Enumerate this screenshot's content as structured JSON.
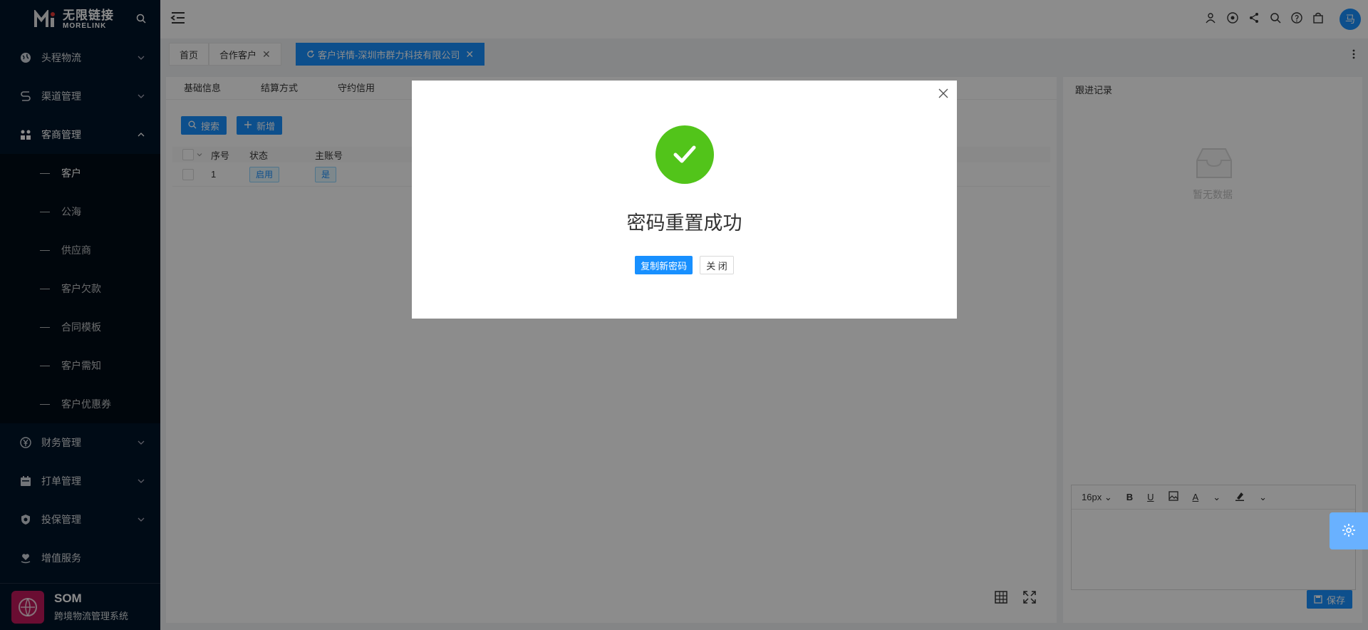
{
  "brand": {
    "name_cn": "无限链接",
    "name_en": "MORELINK",
    "footer_title": "SOM",
    "footer_subtitle": "跨境物流管理系统"
  },
  "sidebar": {
    "menu_top": [
      {
        "label": "头程物流",
        "icon": "globe-icon"
      },
      {
        "label": "渠道管理",
        "icon": "route-icon"
      }
    ],
    "open_menu": {
      "label": "客商管理",
      "icon": "partners-icon"
    },
    "sub_items": [
      {
        "label": "客户"
      },
      {
        "label": "公海"
      },
      {
        "label": "供应商"
      },
      {
        "label": "客户欠款"
      },
      {
        "label": "合同模板"
      },
      {
        "label": "客户需知"
      },
      {
        "label": "客户优惠券"
      }
    ],
    "menu_bottom": [
      {
        "label": "财务管理",
        "icon": "yen-icon"
      },
      {
        "label": "打单管理",
        "icon": "calendar-icon"
      },
      {
        "label": "投保管理",
        "icon": "shield-icon"
      },
      {
        "label": "增值服务",
        "icon": "heart-hand-icon"
      }
    ]
  },
  "header": {
    "avatar_text": "马"
  },
  "tabs": [
    {
      "label": "首页"
    },
    {
      "label": "合作客户",
      "close": "✕"
    },
    {
      "label": "客户详情-深圳市群力科技有限公司",
      "close": "✕"
    }
  ],
  "main": {
    "sub_tabs": [
      "基础信息",
      "结算方式",
      "守约信用"
    ],
    "buttons": {
      "search": "搜索",
      "add": "新增"
    },
    "columns": {
      "seq": "序号",
      "status": "状态",
      "main_account": "主账号"
    },
    "rows": [
      {
        "seq": "1",
        "status": "启用",
        "main_account": "是"
      }
    ]
  },
  "right_panel": {
    "title": "跟进记录",
    "empty_text": "暂无数据",
    "font_size": "16px",
    "save_label": "保存"
  },
  "modal": {
    "title": "密码重置成功",
    "copy_button": "复制新密码",
    "close_button": "关 闭"
  },
  "colors": {
    "primary": "#1890ff",
    "success": "#52c41a",
    "sidebar_bg": "#001529"
  }
}
